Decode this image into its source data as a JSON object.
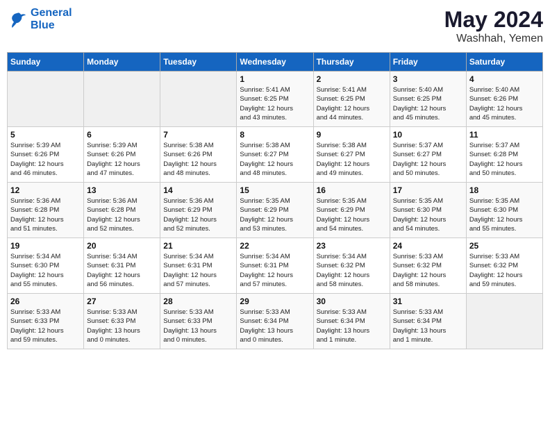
{
  "header": {
    "logo_line1": "General",
    "logo_line2": "Blue",
    "month_year": "May 2024",
    "location": "Washhah, Yemen"
  },
  "days_of_week": [
    "Sunday",
    "Monday",
    "Tuesday",
    "Wednesday",
    "Thursday",
    "Friday",
    "Saturday"
  ],
  "weeks": [
    [
      {
        "day": "",
        "info": ""
      },
      {
        "day": "",
        "info": ""
      },
      {
        "day": "",
        "info": ""
      },
      {
        "day": "1",
        "info": "Sunrise: 5:41 AM\nSunset: 6:25 PM\nDaylight: 12 hours\nand 43 minutes."
      },
      {
        "day": "2",
        "info": "Sunrise: 5:41 AM\nSunset: 6:25 PM\nDaylight: 12 hours\nand 44 minutes."
      },
      {
        "day": "3",
        "info": "Sunrise: 5:40 AM\nSunset: 6:25 PM\nDaylight: 12 hours\nand 45 minutes."
      },
      {
        "day": "4",
        "info": "Sunrise: 5:40 AM\nSunset: 6:26 PM\nDaylight: 12 hours\nand 45 minutes."
      }
    ],
    [
      {
        "day": "5",
        "info": "Sunrise: 5:39 AM\nSunset: 6:26 PM\nDaylight: 12 hours\nand 46 minutes."
      },
      {
        "day": "6",
        "info": "Sunrise: 5:39 AM\nSunset: 6:26 PM\nDaylight: 12 hours\nand 47 minutes."
      },
      {
        "day": "7",
        "info": "Sunrise: 5:38 AM\nSunset: 6:26 PM\nDaylight: 12 hours\nand 48 minutes."
      },
      {
        "day": "8",
        "info": "Sunrise: 5:38 AM\nSunset: 6:27 PM\nDaylight: 12 hours\nand 48 minutes."
      },
      {
        "day": "9",
        "info": "Sunrise: 5:38 AM\nSunset: 6:27 PM\nDaylight: 12 hours\nand 49 minutes."
      },
      {
        "day": "10",
        "info": "Sunrise: 5:37 AM\nSunset: 6:27 PM\nDaylight: 12 hours\nand 50 minutes."
      },
      {
        "day": "11",
        "info": "Sunrise: 5:37 AM\nSunset: 6:28 PM\nDaylight: 12 hours\nand 50 minutes."
      }
    ],
    [
      {
        "day": "12",
        "info": "Sunrise: 5:36 AM\nSunset: 6:28 PM\nDaylight: 12 hours\nand 51 minutes."
      },
      {
        "day": "13",
        "info": "Sunrise: 5:36 AM\nSunset: 6:28 PM\nDaylight: 12 hours\nand 52 minutes."
      },
      {
        "day": "14",
        "info": "Sunrise: 5:36 AM\nSunset: 6:29 PM\nDaylight: 12 hours\nand 52 minutes."
      },
      {
        "day": "15",
        "info": "Sunrise: 5:35 AM\nSunset: 6:29 PM\nDaylight: 12 hours\nand 53 minutes."
      },
      {
        "day": "16",
        "info": "Sunrise: 5:35 AM\nSunset: 6:29 PM\nDaylight: 12 hours\nand 54 minutes."
      },
      {
        "day": "17",
        "info": "Sunrise: 5:35 AM\nSunset: 6:30 PM\nDaylight: 12 hours\nand 54 minutes."
      },
      {
        "day": "18",
        "info": "Sunrise: 5:35 AM\nSunset: 6:30 PM\nDaylight: 12 hours\nand 55 minutes."
      }
    ],
    [
      {
        "day": "19",
        "info": "Sunrise: 5:34 AM\nSunset: 6:30 PM\nDaylight: 12 hours\nand 55 minutes."
      },
      {
        "day": "20",
        "info": "Sunrise: 5:34 AM\nSunset: 6:31 PM\nDaylight: 12 hours\nand 56 minutes."
      },
      {
        "day": "21",
        "info": "Sunrise: 5:34 AM\nSunset: 6:31 PM\nDaylight: 12 hours\nand 57 minutes."
      },
      {
        "day": "22",
        "info": "Sunrise: 5:34 AM\nSunset: 6:31 PM\nDaylight: 12 hours\nand 57 minutes."
      },
      {
        "day": "23",
        "info": "Sunrise: 5:34 AM\nSunset: 6:32 PM\nDaylight: 12 hours\nand 58 minutes."
      },
      {
        "day": "24",
        "info": "Sunrise: 5:33 AM\nSunset: 6:32 PM\nDaylight: 12 hours\nand 58 minutes."
      },
      {
        "day": "25",
        "info": "Sunrise: 5:33 AM\nSunset: 6:32 PM\nDaylight: 12 hours\nand 59 minutes."
      }
    ],
    [
      {
        "day": "26",
        "info": "Sunrise: 5:33 AM\nSunset: 6:33 PM\nDaylight: 12 hours\nand 59 minutes."
      },
      {
        "day": "27",
        "info": "Sunrise: 5:33 AM\nSunset: 6:33 PM\nDaylight: 13 hours\nand 0 minutes."
      },
      {
        "day": "28",
        "info": "Sunrise: 5:33 AM\nSunset: 6:33 PM\nDaylight: 13 hours\nand 0 minutes."
      },
      {
        "day": "29",
        "info": "Sunrise: 5:33 AM\nSunset: 6:34 PM\nDaylight: 13 hours\nand 0 minutes."
      },
      {
        "day": "30",
        "info": "Sunrise: 5:33 AM\nSunset: 6:34 PM\nDaylight: 13 hours\nand 1 minute."
      },
      {
        "day": "31",
        "info": "Sunrise: 5:33 AM\nSunset: 6:34 PM\nDaylight: 13 hours\nand 1 minute."
      },
      {
        "day": "",
        "info": ""
      }
    ]
  ]
}
